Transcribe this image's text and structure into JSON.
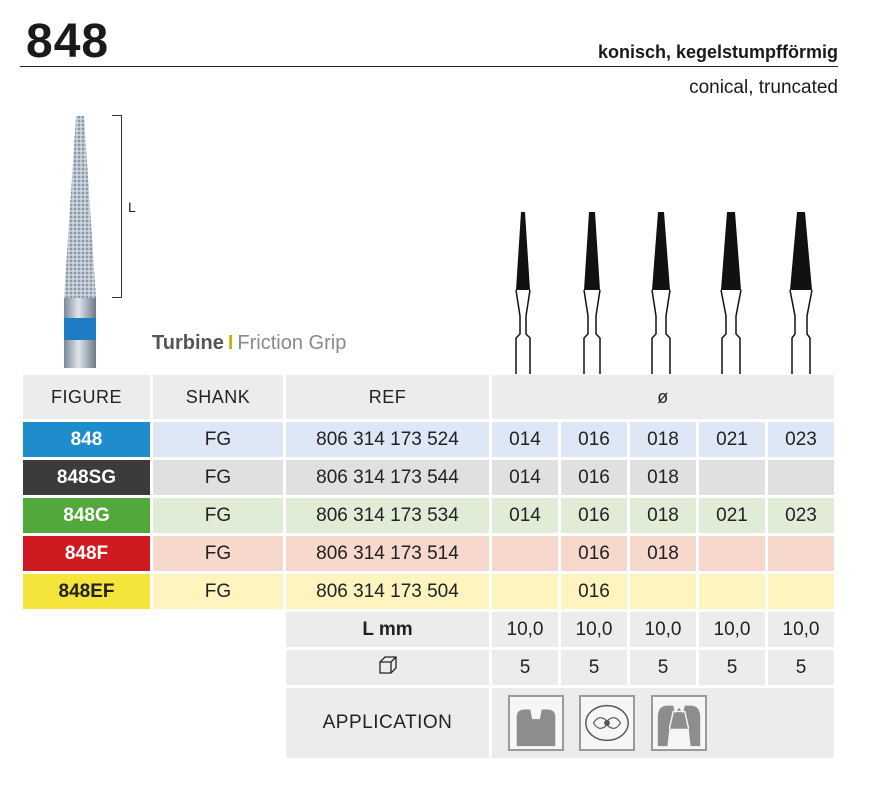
{
  "header": {
    "number": "848",
    "shape_de": "konisch, kegelstumpfförmig",
    "shape_en": "conical, truncated",
    "length_marker": "L"
  },
  "shank_type": {
    "primary": "Turbine",
    "separator": "I",
    "secondary": "Friction Grip"
  },
  "table": {
    "headers": {
      "figure": "FIGURE",
      "shank": "SHANK",
      "ref": "REF",
      "diameter": "ø"
    },
    "rows": [
      {
        "figure": "848",
        "shank": "FG",
        "ref": "806 314 173 524",
        "sizes": [
          "014",
          "016",
          "018",
          "021",
          "023"
        ],
        "color": "#1f8ccb"
      },
      {
        "figure": "848SG",
        "shank": "FG",
        "ref": "806 314 173 544",
        "sizes": [
          "014",
          "016",
          "018",
          "",
          ""
        ],
        "color": "#3b3b3b"
      },
      {
        "figure": "848G",
        "shank": "FG",
        "ref": "806 314 173 534",
        "sizes": [
          "014",
          "016",
          "018",
          "021",
          "023"
        ],
        "color": "#52a83a"
      },
      {
        "figure": "848F",
        "shank": "FG",
        "ref": "806 314 173 514",
        "sizes": [
          "",
          "016",
          "018",
          "",
          ""
        ],
        "color": "#cf1a22"
      },
      {
        "figure": "848EF",
        "shank": "FG",
        "ref": "806 314 173 504",
        "sizes": [
          "",
          "016",
          "",
          "",
          ""
        ],
        "color": "#f5e53a"
      }
    ],
    "length_label": "L mm",
    "lengths": [
      "10,0",
      "10,0",
      "10,0",
      "10,0",
      "10,0"
    ],
    "pack_icon": "package-box-icon",
    "pack_quantities": [
      "5",
      "5",
      "5",
      "5",
      "5"
    ],
    "application_label": "APPLICATION",
    "application_icons": [
      "tooth-cavity-icon",
      "tooth-occlusal-icon",
      "tooth-crown-prep-icon"
    ]
  }
}
